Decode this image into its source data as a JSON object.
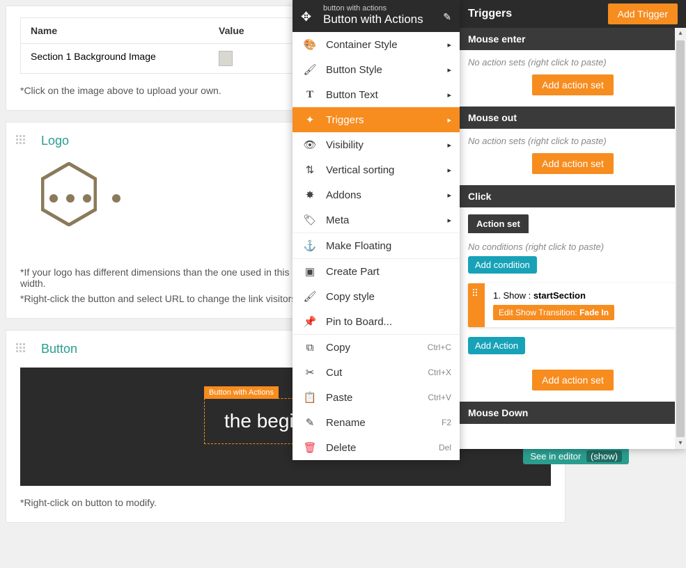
{
  "left": {
    "table": {
      "h_name": "Name",
      "h_value": "Value",
      "row1_name": "Section 1 Background Image"
    },
    "img_hint": "*Click on the image above to upload your own.",
    "logo_title": "Logo",
    "logo_hint1": "*If your logo has different dimensions than the one used in this page, then right-click on it to open the menu and adjust its width.",
    "logo_hint2": "*Right-click the button and select URL to change the link visitors get directed to.",
    "button_title": "Button",
    "begin_label": "Button with Actions",
    "begin_text": "the beginning.",
    "editor_chip": "See in editor",
    "editor_show": "(show)",
    "button_hint": "*Right-click on button to modify."
  },
  "ctx": {
    "sub": "button with actions",
    "title": "Button with Actions",
    "items": {
      "container": "Container Style",
      "button_style": "Button Style",
      "button_text": "Button Text",
      "triggers": "Triggers",
      "visibility": "Visibility",
      "vsort": "Vertical sorting",
      "addons": "Addons",
      "meta": "Meta",
      "float": "Make Floating",
      "create_part": "Create Part",
      "copy_style": "Copy style",
      "pin": "Pin to Board...",
      "copy": "Copy",
      "cut": "Cut",
      "paste": "Paste",
      "rename": "Rename",
      "delete": "Delete"
    },
    "sc": {
      "copy": "Ctrl+C",
      "cut": "Ctrl+X",
      "paste": "Ctrl+V",
      "rename": "F2",
      "delete": "Del"
    }
  },
  "panel": {
    "title": "Triggers",
    "add_trigger": "Add Trigger",
    "no_actions": "No action sets (right click to paste)",
    "add_set": "Add action set",
    "triggers": {
      "mouseenter": "Mouse enter",
      "mouseout": "Mouse out",
      "click": "Click",
      "mousedown": "Mouse Down"
    },
    "action_set_tab": "Action set",
    "no_cond": "No conditions (right click to paste)",
    "add_cond": "Add condition",
    "action_1_pre": "1. Show : ",
    "action_1_target": "startSection",
    "edit_trans_pre": "Edit Show Transition: ",
    "edit_trans_val": "Fade In",
    "add_action": "Add Action"
  }
}
